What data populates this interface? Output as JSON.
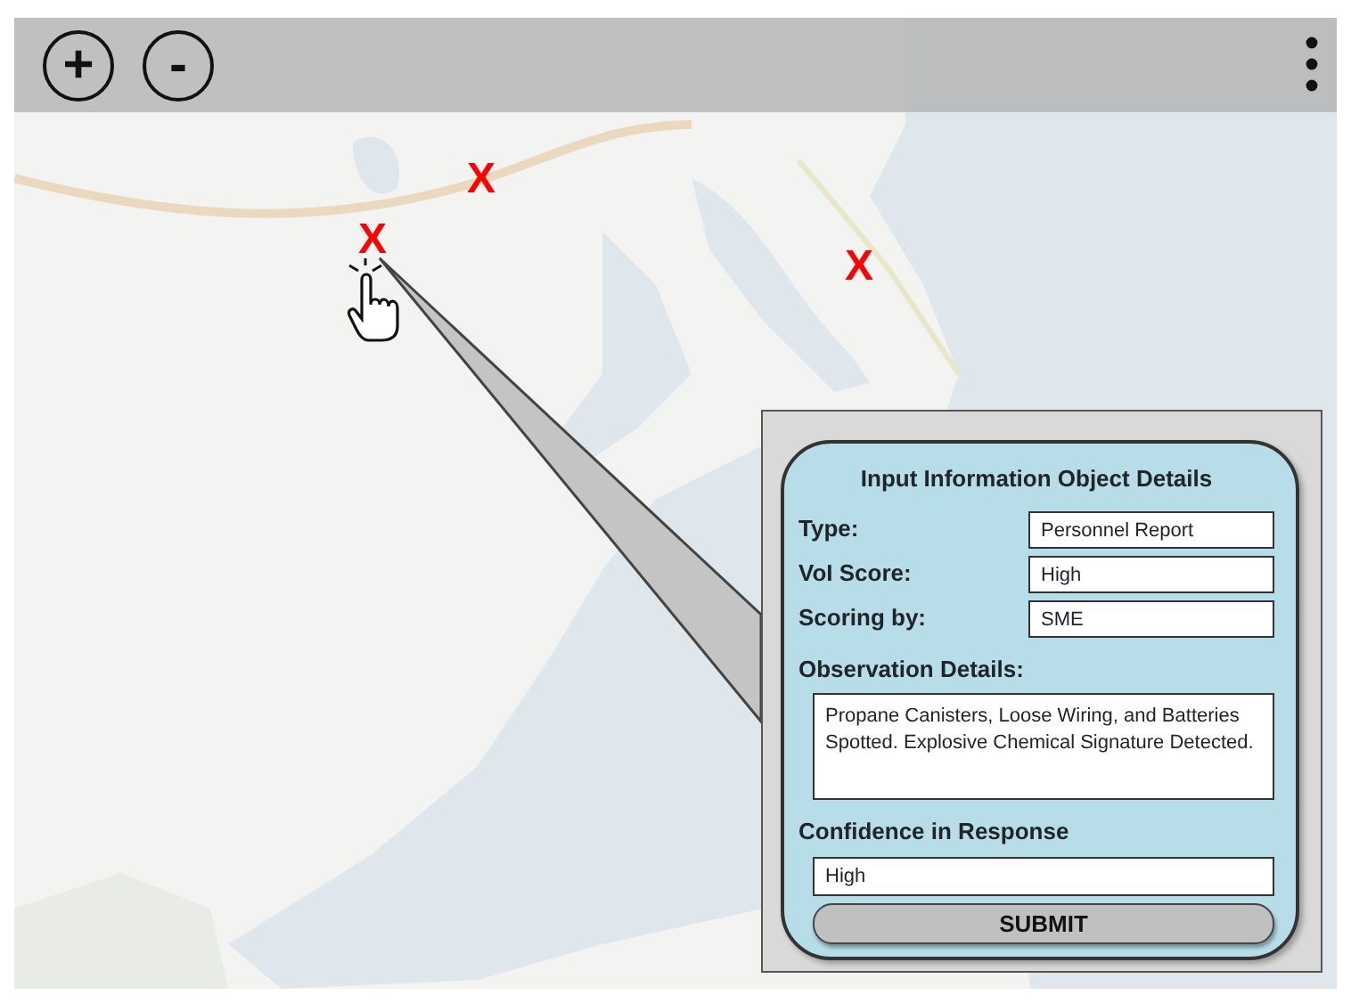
{
  "toolbar": {
    "zoom_in": "+",
    "zoom_out": "-"
  },
  "markers": [
    {
      "label": "X",
      "selected": true
    },
    {
      "label": "X",
      "selected": false
    },
    {
      "label": "X",
      "selected": false
    }
  ],
  "details_panel": {
    "title": "Input Information Object Details",
    "fields": [
      {
        "label": "Type:",
        "value": "Personnel Report"
      },
      {
        "label": "VoI Score:",
        "value": "High"
      },
      {
        "label": "Scoring by:",
        "value": "SME"
      }
    ],
    "observation": {
      "label": "Observation Details:",
      "value": "Propane Canisters, Loose Wiring, and Batteries Spotted.  Explosive Chemical Signature Detected."
    },
    "confidence": {
      "label": "Confidence in Response",
      "value": "High"
    },
    "submit": "SUBMIT"
  }
}
